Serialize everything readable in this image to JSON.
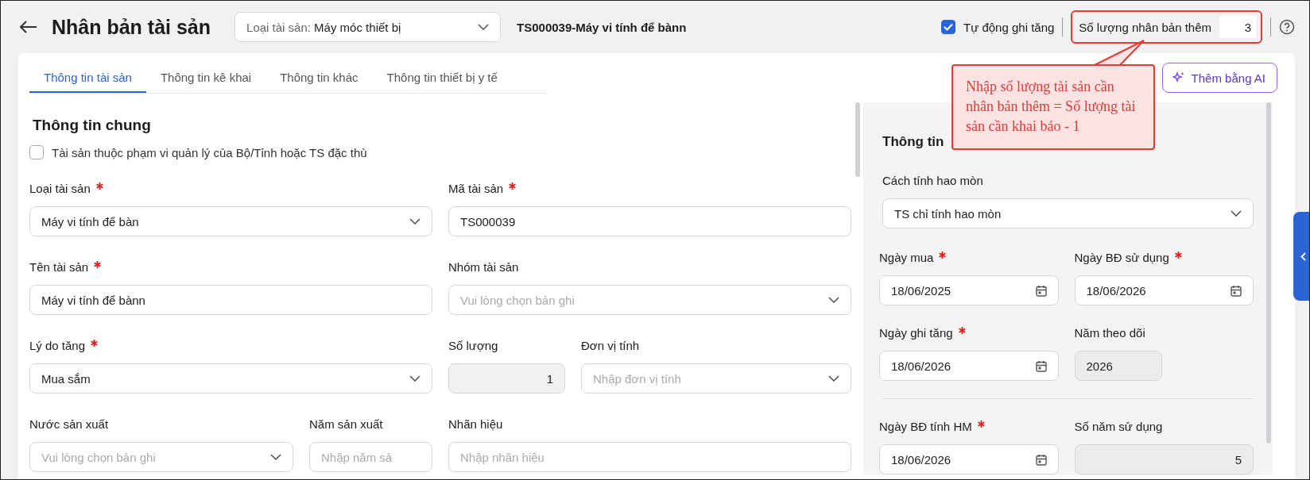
{
  "header": {
    "title": "Nhân bản tài sản",
    "asset_type_filter": {
      "label": "Loại tài sản:",
      "value": "Máy móc thiết bị"
    },
    "asset_code_title": "TS000039-Máy vi tính để bànn",
    "auto_increase": {
      "label": "Tự động ghi tăng",
      "checked": true
    },
    "duplicate_count": {
      "label": "Số lượng nhân bản thêm",
      "value": "3"
    }
  },
  "tabs": [
    {
      "label": "Thông tin tài sản",
      "selected": true
    },
    {
      "label": "Thông tin kê khai",
      "selected": false
    },
    {
      "label": "Thông tin khác",
      "selected": false
    },
    {
      "label": "Thông tin thiết bị y tế",
      "selected": false
    }
  ],
  "ai_button": {
    "label": "Thêm bằng AI"
  },
  "callout": {
    "text": "Nhập số lượng tài sản cần nhân bản thêm = Số lượng tài sản cần khai báo - 1"
  },
  "general": {
    "title": "Thông tin chung",
    "scope_checkbox": {
      "label": "Tài sản thuộc phạm vi quản lý của Bộ/Tỉnh hoặc TS đặc thù",
      "checked": false
    },
    "rows": [
      [
        [
          {
            "label": "Loại tài sản",
            "required": true,
            "kind": "select",
            "value": "Máy vi tính để bàn"
          }
        ],
        [
          {
            "label": "Mã tài sản",
            "required": true,
            "kind": "text",
            "value": "TS000039"
          }
        ]
      ],
      [
        [
          {
            "label": "Tên tài sản",
            "required": true,
            "kind": "text",
            "value": "Máy vi tính để bànn"
          }
        ],
        [
          {
            "label": "Nhóm tài sản",
            "required": false,
            "kind": "select",
            "placeholder": "Vui lòng chọn bản ghi"
          }
        ]
      ],
      [
        [
          {
            "label": "Lý do tăng",
            "required": true,
            "kind": "select",
            "value": "Mua sắm"
          }
        ],
        [
          {
            "label": "Số lượng",
            "required": false,
            "kind": "number",
            "value": "1"
          },
          {
            "label": "Đơn vị tính",
            "required": false,
            "kind": "select",
            "placeholder": "Nhập đơn vị tính"
          }
        ]
      ],
      [
        [
          {
            "label": "Nước sản xuất",
            "required": false,
            "kind": "select",
            "placeholder": "Vui lòng chọn bản ghi"
          },
          {
            "label": "Năm sản xuất",
            "required": false,
            "kind": "text",
            "placeholder": "Nhập năm sả"
          }
        ],
        [
          {
            "label": "Nhãn hiệu",
            "required": false,
            "kind": "text",
            "placeholder": "Nhập nhãn hiệu"
          }
        ]
      ]
    ]
  },
  "depreciation": {
    "title": "Thông tin",
    "method": {
      "label": "Cách tính hao mòn",
      "value": "TS chỉ tính hao mòn"
    },
    "groups": [
      [
        [
          {
            "label": "Ngày mua",
            "required": true,
            "kind": "date",
            "value": "18/06/2025"
          },
          {
            "label": "Ngày BĐ sử dụng",
            "required": true,
            "kind": "date",
            "value": "18/06/2026"
          }
        ],
        [
          {
            "label": "Ngày ghi tăng",
            "required": true,
            "kind": "date",
            "value": "18/06/2026"
          },
          {
            "label": "Năm theo dõi",
            "required": false,
            "kind": "readonly",
            "value": "2026"
          }
        ]
      ],
      [
        [
          {
            "label": "Ngày BĐ tính HM",
            "required": true,
            "kind": "date",
            "value": "18/06/2026"
          },
          {
            "label": "Số năm sử dụng",
            "required": false,
            "kind": "number",
            "value": "5"
          }
        ]
      ]
    ]
  }
}
